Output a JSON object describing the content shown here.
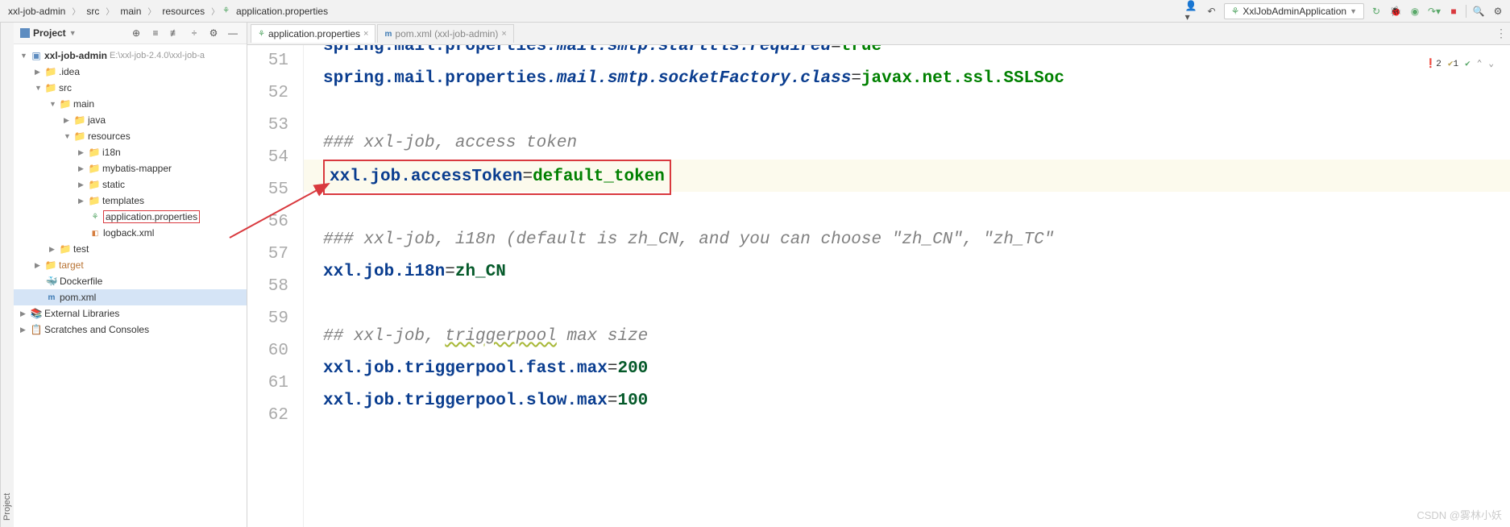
{
  "breadcrumb": [
    "xxl-job-admin",
    "src",
    "main",
    "resources",
    "application.properties"
  ],
  "run_config": "XxlJobAdminApplication",
  "panel": {
    "title": "Project"
  },
  "side_tab": "Project",
  "tree": {
    "root": "xxl-job-admin",
    "root_path": "E:\\xxl-job-2.4.0\\xxl-job-a",
    "idea": ".idea",
    "src": "src",
    "main": "main",
    "java": "java",
    "resources": "resources",
    "i18n": "i18n",
    "mybatis": "mybatis-mapper",
    "static": "static",
    "templates": "templates",
    "appprops": "application.properties",
    "logback": "logback.xml",
    "test": "test",
    "target": "target",
    "dockerfile": "Dockerfile",
    "pom": "pom.xml",
    "extlib": "External Libraries",
    "scratches": "Scratches and Consoles"
  },
  "tabs": {
    "t1": "application.properties",
    "t2": "pom.xml (xxl-job-admin)"
  },
  "indicators": {
    "errors": "2",
    "warnings": "1"
  },
  "gutter": [
    "51",
    "52",
    "53",
    "54",
    "55",
    "56",
    "57",
    "58",
    "59",
    "60",
    "61",
    "62"
  ],
  "code": {
    "l51_k": "spring.mail.properties",
    "l51_i": ".mail.smtp.starttls.required",
    "l51_v": "true",
    "l52_k": "spring.mail.properties",
    "l52_i": ".mail.smtp.socketFactory.class",
    "l52_v": "javax.net.ssl.SSLSoc",
    "l54": "### xxl-job, access token",
    "l55_k": "xxl.job.accessToken",
    "l55_v": "default_token",
    "l57": "### xxl-job, i18n (default is zh_CN, and you can choose \"zh_CN\", \"zh_TC\"",
    "l58_k": "xxl.job.i18n",
    "l58_v": "zh_CN",
    "l60_a": "## xxl-job, ",
    "l60_b": "triggerpool",
    "l60_c": " max size",
    "l61_k": "xxl.job.triggerpool.fast.max",
    "l61_v": "200",
    "l62_k": "xxl.job.triggerpool.slow.max",
    "l62_v": "100"
  },
  "watermark": "CSDN @雾林小妖"
}
